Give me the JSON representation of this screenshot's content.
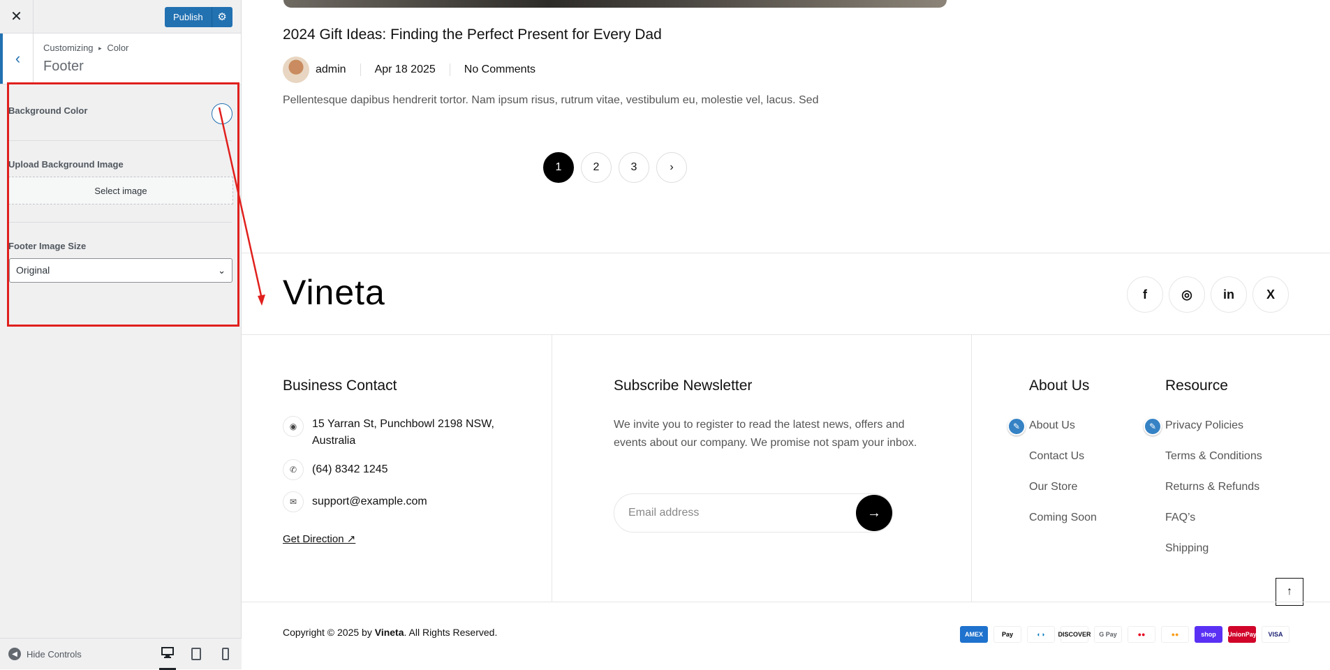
{
  "customizer": {
    "close_icon": "✕",
    "publish_label": "Publish",
    "gear_icon": "⚙",
    "back_icon": "‹",
    "breadcrumb_root": "Customizing",
    "breadcrumb_sep": "▸",
    "breadcrumb_section": "Color",
    "panel_title": "Footer",
    "controls": {
      "bg_color_label": "Background Color",
      "upload_label": "Upload Background Image",
      "select_image": "Select image",
      "size_label": "Footer Image Size",
      "size_value": "Original"
    },
    "hide_controls": "Hide Controls",
    "devices": [
      "desktop",
      "tablet",
      "mobile"
    ],
    "accent_color": "#2271b1",
    "annotation_color": "#e0201d"
  },
  "post": {
    "title": "2024 Gift Ideas: Finding the Perfect Present for Every Dad",
    "author": "admin",
    "date": "Apr 18 2025",
    "comments": "No Comments",
    "excerpt": "Pellentesque dapibus hendrerit tortor. Nam ipsum risus, rutrum vitae, vestibulum eu, molestie vel, lacus. Sed"
  },
  "pagination": {
    "pages": [
      "1",
      "2",
      "3"
    ],
    "current": "1",
    "next_icon": "›"
  },
  "footer": {
    "logo": "Vineta",
    "social": [
      {
        "name": "facebook-icon",
        "glyph": "f"
      },
      {
        "name": "instagram-icon",
        "glyph": "◎"
      },
      {
        "name": "linkedin-icon",
        "glyph": "in"
      },
      {
        "name": "x-icon",
        "glyph": "X"
      }
    ],
    "contact": {
      "heading": "Business Contact",
      "address": "15 Yarran St, Punchbowl 2198 NSW, Australia",
      "phone": "(64) 8342 1245",
      "email": "support@example.com",
      "direction": "Get Direction ↗"
    },
    "newsletter": {
      "heading": "Subscribe Newsletter",
      "text": "We invite you to register to read the latest news, offers and events about our company. We promise not spam your inbox.",
      "placeholder": "Email address"
    },
    "about": {
      "heading": "About Us",
      "links": [
        "About Us",
        "Contact Us",
        "Our Store",
        "Coming Soon"
      ]
    },
    "resource": {
      "heading": "Resource",
      "links": [
        "Privacy Policies",
        "Terms & Conditions",
        "Returns & Refunds",
        "FAQ’s",
        "Shipping"
      ]
    },
    "copyright_prefix": "Copyright © 2025 by ",
    "copyright_brand": "Vineta",
    "copyright_suffix": ". All Rights Reserved.",
    "payments": [
      {
        "name": "amex-icon",
        "label": "AMEX",
        "bg": "#1f72cd",
        "fg": "#ffffff"
      },
      {
        "name": "apple-pay-icon",
        "label": "Pay",
        "bg": "#ffffff",
        "fg": "#000000"
      },
      {
        "name": "diners-icon",
        "label": "◐◑",
        "bg": "#ffffff",
        "fg": "#0079be"
      },
      {
        "name": "discover-icon",
        "label": "DISCOVER",
        "bg": "#ffffff",
        "fg": "#111111"
      },
      {
        "name": "google-pay-icon",
        "label": "G Pay",
        "bg": "#ffffff",
        "fg": "#5f6368"
      },
      {
        "name": "maestro-icon",
        "label": "●●",
        "bg": "#ffffff",
        "fg": "#e6001e"
      },
      {
        "name": "mastercard-icon",
        "label": "●●",
        "bg": "#ffffff",
        "fg": "#f79e1b"
      },
      {
        "name": "shop-pay-icon",
        "label": "shop",
        "bg": "#5a31f4",
        "fg": "#ffffff"
      },
      {
        "name": "unionpay-icon",
        "label": "UnionPay",
        "bg": "#d10429",
        "fg": "#ffffff"
      },
      {
        "name": "visa-icon",
        "label": "VISA",
        "bg": "#ffffff",
        "fg": "#1a1f71"
      }
    ]
  }
}
